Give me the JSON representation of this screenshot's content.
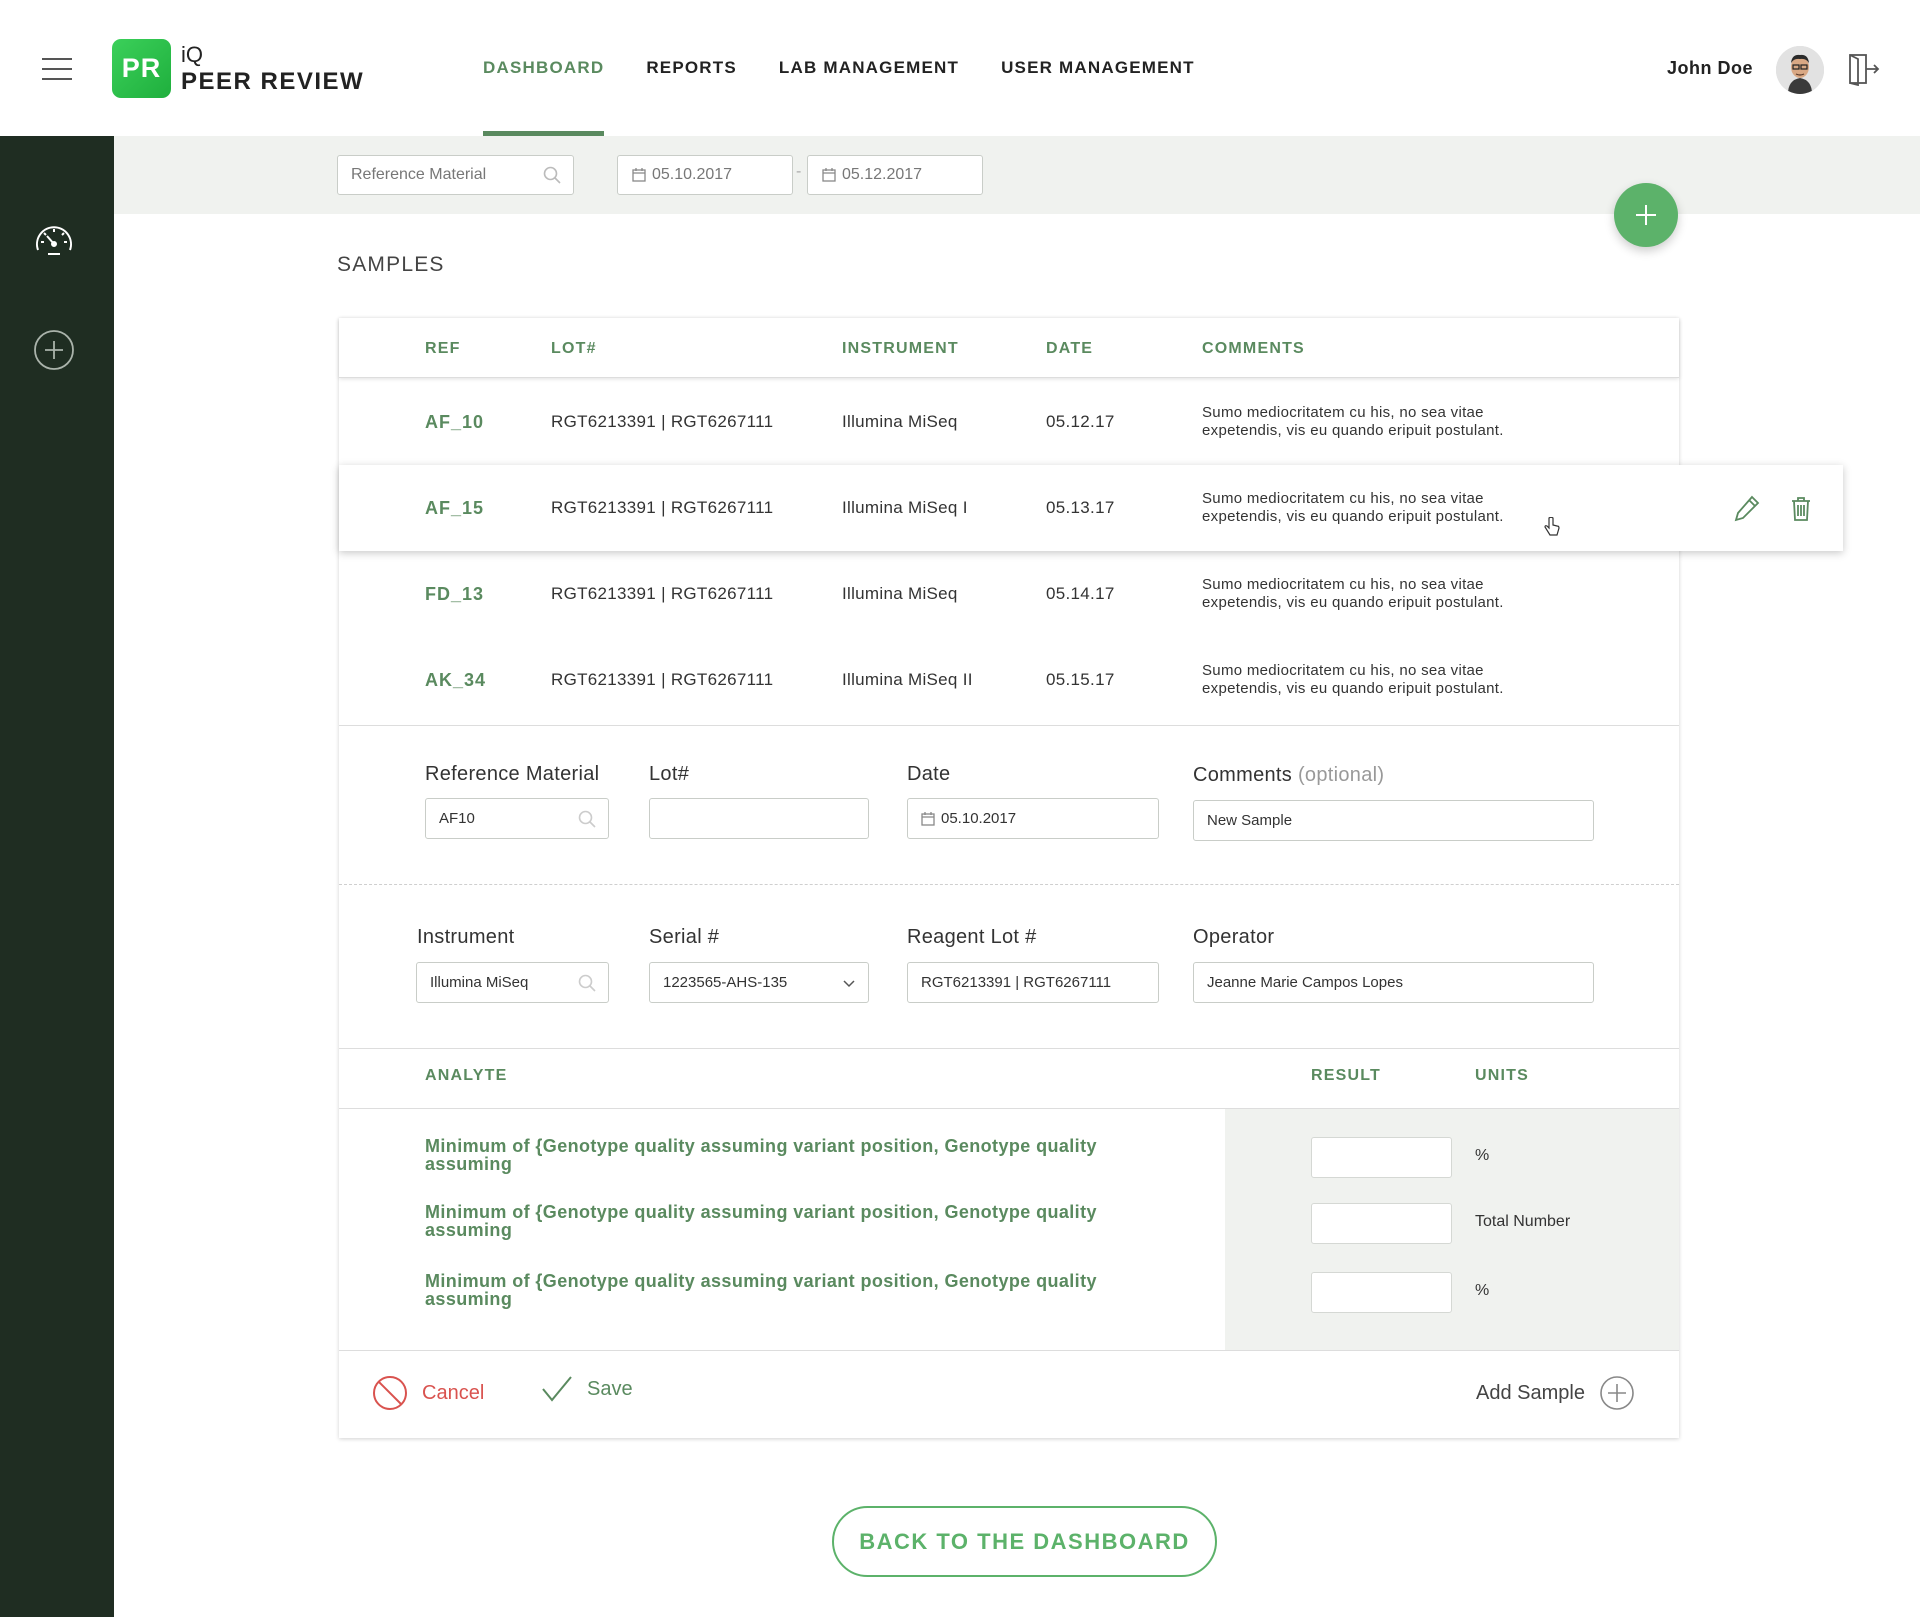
{
  "header": {
    "logo_badge": "PR",
    "logo_small": "iQ",
    "logo_name": "PEER REVIEW",
    "nav": [
      {
        "label": "DASHBOARD",
        "active": true
      },
      {
        "label": "REPORTS",
        "active": false
      },
      {
        "label": "LAB MANAGEMENT",
        "active": false
      },
      {
        "label": "USER MANAGEMENT",
        "active": false
      }
    ],
    "user_name": "John Doe"
  },
  "filters": {
    "reference_placeholder": "Reference Material",
    "date_from": "05.10.2017",
    "date_to": "05.12.2017",
    "date_separator": "-"
  },
  "samples": {
    "title": "SAMPLES",
    "columns": [
      "REF",
      "LOT#",
      "INSTRUMENT",
      "DATE",
      "COMMENTS"
    ],
    "rows": [
      {
        "ref": "AF_10",
        "lot": "RGT6213391 | RGT6267111",
        "instrument": "Illumina MiSeq",
        "date": "05.12.17",
        "comments": "Sumo mediocritatem cu his, no sea vitae expetendis, vis eu quando eripuit postulant."
      },
      {
        "ref": "AF_15",
        "lot": "RGT6213391 | RGT6267111",
        "instrument": "Illumina MiSeq I",
        "date": "05.13.17",
        "comments": "Sumo mediocritatem cu his, no sea vitae expetendis, vis eu quando eripuit postulant."
      },
      {
        "ref": "FD_13",
        "lot": "RGT6213391 | RGT6267111",
        "instrument": "Illumina MiSeq",
        "date": "05.14.17",
        "comments": "Sumo mediocritatem cu his, no sea vitae expetendis, vis eu quando eripuit postulant."
      },
      {
        "ref": "AK_34",
        "lot": "RGT6213391 | RGT6267111",
        "instrument": "Illumina MiSeq II",
        "date": "05.15.17",
        "comments": "Sumo mediocritatem cu his, no sea vitae expetendis, vis eu quando eripuit postulant."
      }
    ]
  },
  "form": {
    "reference_label": "Reference Material",
    "reference_value": "AF10",
    "lot_label": "Lot#",
    "lot_value": "",
    "date_label": "Date",
    "date_value": "05.10.2017",
    "comments_label": "Comments",
    "comments_optional": "(optional)",
    "comments_value": "New Sample",
    "instrument_label": "Instrument",
    "instrument_value": "Illumina MiSeq",
    "serial_label": "Serial #",
    "serial_value": "1223565-AHS-135",
    "reagent_label": "Reagent Lot #",
    "reagent_value": "RGT6213391 | RGT6267111",
    "operator_label": "Operator",
    "operator_value": "Jeanne Marie Campos Lopes"
  },
  "analytes": {
    "columns": [
      "ANALYTE",
      "RESULT",
      "UNITS"
    ],
    "rows": [
      {
        "name_line1": "Minimum of {Genotype quality assuming variant position, Genotype quality",
        "name_line2": "assuming",
        "result": "",
        "unit": "%"
      },
      {
        "name_line1": "Minimum of {Genotype quality assuming variant position, Genotype quality",
        "name_line2": "assuming",
        "result": "",
        "unit": "Total Number"
      },
      {
        "name_line1": "Minimum of {Genotype quality assuming variant position, Genotype quality",
        "name_line2": "assuming",
        "result": "",
        "unit": "%"
      }
    ]
  },
  "actions": {
    "cancel": "Cancel",
    "save": "Save",
    "add_sample": "Add Sample",
    "back": "BACK TO THE DASHBOARD"
  },
  "colors": {
    "accent": "#5a8a5f",
    "brand_green": "#5cb26a",
    "sidebar": "#1f2d22",
    "cancel": "#d9534f"
  }
}
